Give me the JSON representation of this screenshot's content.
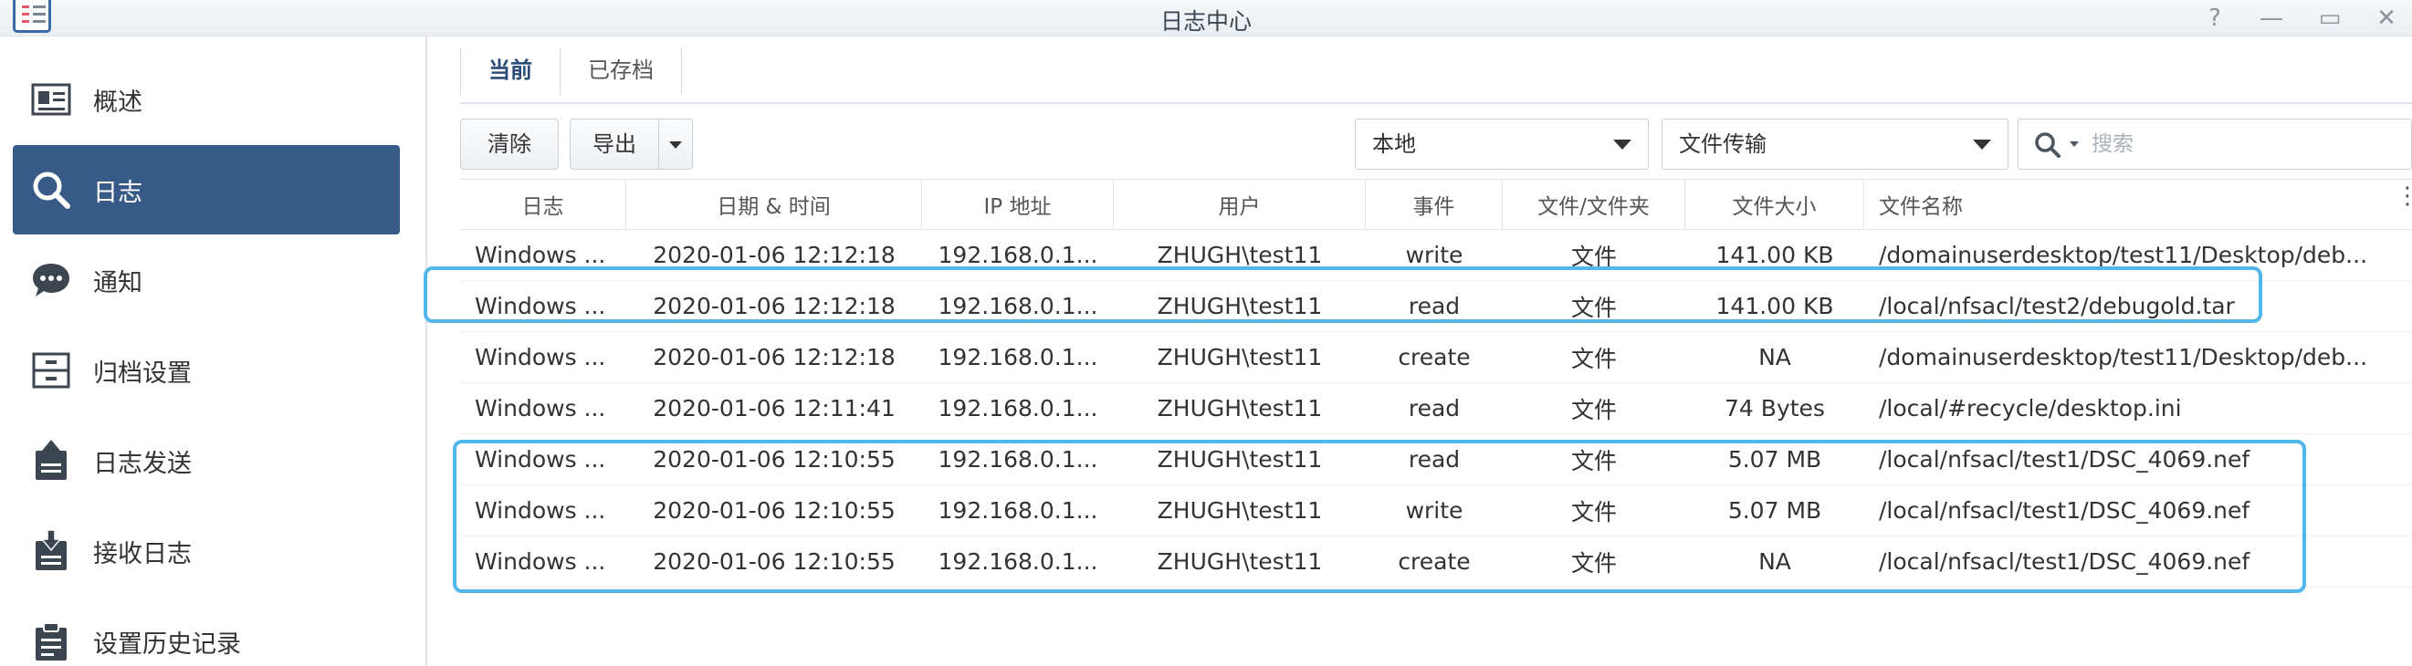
{
  "window": {
    "title": "日志中心"
  },
  "titlebar_buttons": [
    {
      "name": "help-icon",
      "glyph": "?"
    },
    {
      "name": "minimize-icon",
      "glyph": "—"
    },
    {
      "name": "maximize-icon",
      "glyph": "▭"
    },
    {
      "name": "close-icon",
      "glyph": "✕"
    }
  ],
  "sidebar": {
    "items": [
      {
        "label": "概述",
        "icon": "overview-card-icon",
        "active": false
      },
      {
        "label": "日志",
        "icon": "search-icon",
        "active": true
      },
      {
        "label": "通知",
        "icon": "chat-bubble-icon",
        "active": false
      },
      {
        "label": "归档设置",
        "icon": "archive-icon",
        "active": false
      },
      {
        "label": "日志发送",
        "icon": "send-log-icon",
        "active": false
      },
      {
        "label": "接收日志",
        "icon": "receive-log-icon",
        "active": false
      },
      {
        "label": "设置历史记录",
        "icon": "history-clipboard-icon",
        "active": false
      }
    ]
  },
  "tabs": [
    {
      "label": "当前",
      "active": true
    },
    {
      "label": "已存档",
      "active": false
    }
  ],
  "toolbar": {
    "clear_label": "清除",
    "export_label": "导出",
    "location_select": "本地",
    "type_select": "文件传输",
    "search_placeholder": "搜索"
  },
  "table": {
    "columns": [
      "日志",
      "日期 & 时间",
      "IP 地址",
      "用户",
      "事件",
      "文件/文件夹",
      "文件大小",
      "文件名称"
    ],
    "rows": [
      [
        "Windows ...",
        "2020-01-06 12:12:18",
        "192.168.0.1...",
        "ZHUGH\\test11",
        "write",
        "文件",
        "141.00 KB",
        "/domainuserdesktop/test11/Desktop/deb..."
      ],
      [
        "Windows ...",
        "2020-01-06 12:12:18",
        "192.168.0.1...",
        "ZHUGH\\test11",
        "read",
        "文件",
        "141.00 KB",
        "/local/nfsacl/test2/debugold.tar"
      ],
      [
        "Windows ...",
        "2020-01-06 12:12:18",
        "192.168.0.1...",
        "ZHUGH\\test11",
        "create",
        "文件",
        "NA",
        "/domainuserdesktop/test11/Desktop/deb..."
      ],
      [
        "Windows ...",
        "2020-01-06 12:11:41",
        "192.168.0.1...",
        "ZHUGH\\test11",
        "read",
        "文件",
        "74 Bytes",
        "/local/#recycle/desktop.ini"
      ],
      [
        "Windows ...",
        "2020-01-06 12:10:55",
        "192.168.0.1...",
        "ZHUGH\\test11",
        "read",
        "文件",
        "5.07 MB",
        "/local/nfsacl/test1/DSC_4069.nef"
      ],
      [
        "Windows ...",
        "2020-01-06 12:10:55",
        "192.168.0.1...",
        "ZHUGH\\test11",
        "write",
        "文件",
        "5.07 MB",
        "/local/nfsacl/test1/DSC_4069.nef"
      ],
      [
        "Windows ...",
        "2020-01-06 12:10:55",
        "192.168.0.1...",
        "ZHUGH\\test11",
        "create",
        "文件",
        "NA",
        "/local/nfsacl/test1/DSC_4069.nef"
      ]
    ]
  },
  "colors": {
    "accent": "#375a87",
    "highlight": "#52b6ea"
  }
}
